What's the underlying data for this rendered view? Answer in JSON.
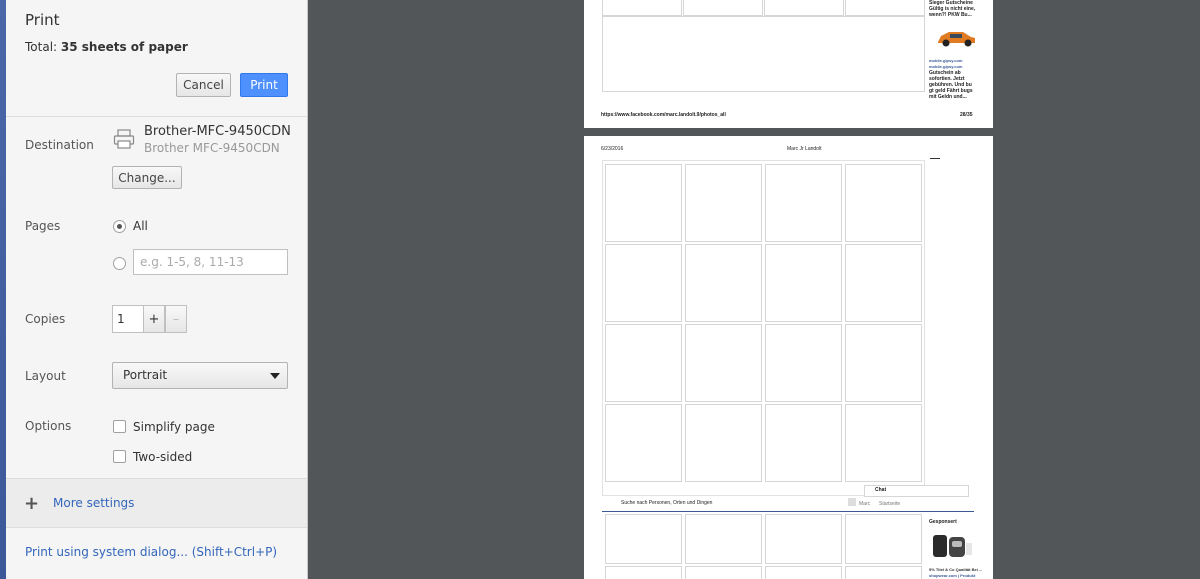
{
  "dialog": {
    "title": "Print",
    "total_label": "Total:",
    "total_value": "35 sheets of paper",
    "cancel_label": "Cancel",
    "print_label": "Print"
  },
  "destination": {
    "label": "Destination",
    "printer_name": "Brother-MFC-9450CDN",
    "printer_sub": "Brother MFC-9450CDN",
    "change_label": "Change..."
  },
  "pages": {
    "label": "Pages",
    "all_label": "All",
    "range_placeholder": "e.g. 1-5, 8, 11-13",
    "selected": "All"
  },
  "copies": {
    "label": "Copies",
    "value": "1",
    "plus": "+",
    "minus": "–"
  },
  "layout": {
    "label": "Layout",
    "value": "Portrait"
  },
  "options": {
    "label": "Options",
    "simplify_label": "Simplify page",
    "simplify_checked": false,
    "two_sided_label": "Two-sided",
    "two_sided_checked": false
  },
  "more_settings": {
    "label": "More settings"
  },
  "system_dialog": {
    "label": "Print using system dialog... (Shift+Ctrl+P)"
  },
  "preview": {
    "page1": {
      "footer_url": "https://www.facebook.com/marc.landolt.9/photos_all",
      "page_num": "28/35",
      "side_text_top": "Sieger Gutscheine Gültig is nicht eine, wenn?! PKW Bu...",
      "side_link": "mobile.gipsy.com",
      "side_link2": "mobile.gipsy.com",
      "side_text": "Gutschein ab sofortien. Jetzt gebühren. Und bu gt geld Fährt bugs mit Geldn und..."
    },
    "page2": {
      "date": "6/23/2016",
      "author": "Marc Jr Landolt",
      "search_text": "Suche nach Personen, Orten und Dingen",
      "chat_label": "Chat",
      "sponsored_label": "Gesponsert",
      "nav_home": "Marc",
      "nav_start": "Startseite",
      "ad_text": "5% Titel & Co Qualität Bei ...",
      "ad_link": "shopwear.com | Produkt"
    }
  }
}
